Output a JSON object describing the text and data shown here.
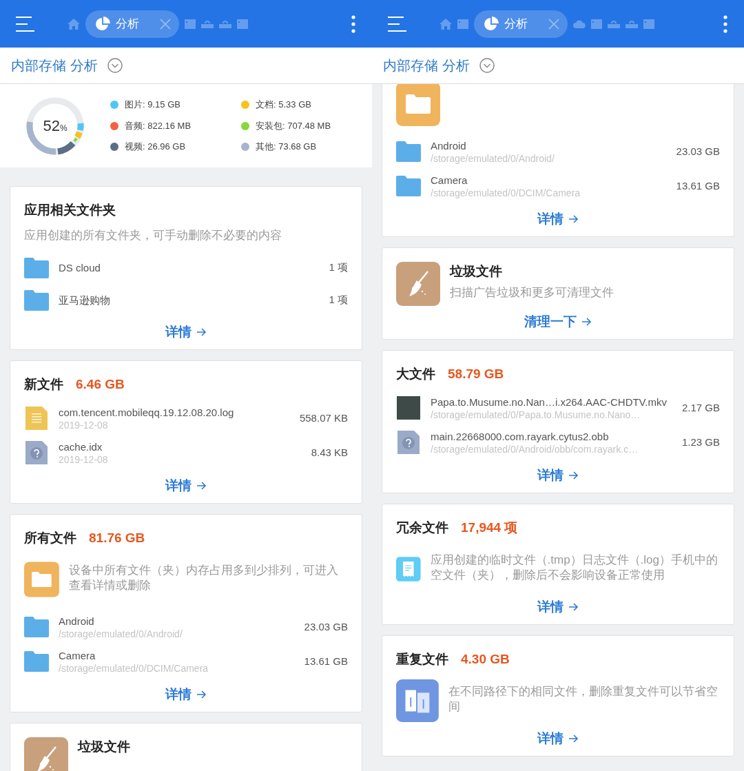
{
  "panes": [
    {
      "tabs": [
        {
          "kind": "home",
          "selected": false
        },
        {
          "kind": "analysis",
          "label": "分析",
          "selected": true
        },
        {
          "kind": "card",
          "selected": false
        },
        {
          "kind": "network",
          "selected": false
        },
        {
          "kind": "network",
          "selected": false
        },
        {
          "kind": "card",
          "selected": false
        }
      ],
      "location": "内部存储 分析",
      "scrolled_to_end": false,
      "summary": {
        "percent": "52",
        "unit": "%",
        "legend": [
          {
            "label": "图片: 9.15 GB",
            "color": "#4dc8f2"
          },
          {
            "label": "文档: 5.33 GB",
            "color": "#f7c21c"
          },
          {
            "label": "音频: 822.16 MB",
            "color": "#f2623e"
          },
          {
            "label": "安装包: 707.48 MB",
            "color": "#86d83a"
          },
          {
            "label": "视频: 26.96 GB",
            "color": "#5b6e85"
          },
          {
            "label": "其他: 73.68 GB",
            "color": "#a5b5cc"
          }
        ]
      },
      "cards": [
        {
          "kind": "plain",
          "title": "应用相关文件夹",
          "description": "应用创建的所有文件夹，可手动删除不必要的内容",
          "rows": [
            {
              "kind": "folder",
              "name": "DS cloud",
              "size": "1 项"
            },
            {
              "kind": "folder",
              "name": "亚马逊购物",
              "size": "1 项"
            }
          ],
          "action": "详情"
        },
        {
          "kind": "plain",
          "title": "新文件",
          "amount": "6.46 GB",
          "rows": [
            {
              "kind": "text-file",
              "name": "com.tencent.mobileqq.19.12.08.20.log",
              "sub": "2019-12-08",
              "size": "558.07 KB"
            },
            {
              "kind": "unknown-file",
              "name": "cache.idx",
              "sub": "2019-12-08",
              "size": "8.43 KB"
            }
          ],
          "action": "详情"
        },
        {
          "kind": "all-files",
          "title": "所有文件",
          "amount": "81.76 GB",
          "description": "设备中所有文件（夹）内存占用多到少排列，可进入查看详情或删除",
          "rows": [
            {
              "kind": "folder",
              "name": "Android",
              "sub": "/storage/emulated/0/Android/",
              "size": "23.03 GB"
            },
            {
              "kind": "folder",
              "name": "Camera",
              "sub": "/storage/emulated/0/DCIM/Camera",
              "size": "13.61 GB"
            }
          ],
          "action": "详情"
        },
        {
          "kind": "junk",
          "title": "垃圾文件"
        }
      ]
    },
    {
      "tabs": [
        {
          "kind": "home",
          "selected": false
        },
        {
          "kind": "card",
          "selected": false
        },
        {
          "kind": "analysis",
          "label": "分析",
          "selected": true
        },
        {
          "kind": "cloud",
          "selected": false
        },
        {
          "kind": "card",
          "selected": false
        },
        {
          "kind": "network",
          "selected": false
        },
        {
          "kind": "network",
          "selected": false
        },
        {
          "kind": "card",
          "selected": false
        }
      ],
      "location": "内部存储 分析",
      "scrolled_to_end": true,
      "cards": [
        {
          "kind": "all-files",
          "rows": [
            {
              "kind": "folder",
              "name": "Android",
              "sub": "/storage/emulated/0/Android/",
              "size": "23.03 GB"
            },
            {
              "kind": "folder",
              "name": "Camera",
              "sub": "/storage/emulated/0/DCIM/Camera",
              "size": "13.61 GB"
            }
          ],
          "action": "详情"
        },
        {
          "kind": "junk",
          "title": "垃圾文件",
          "description": "扫描广告垃圾和更多可清理文件",
          "action": "清理一下"
        },
        {
          "kind": "plain",
          "title": "大文件",
          "amount": "58.79 GB",
          "rows": [
            {
              "kind": "video",
              "name": "Papa.to.Musume.no.Nan…i.x264.AAC-CHDTV.mkv",
              "sub": "/storage/emulated/0/Papa.to.Musume.no.Nano…",
              "size": "2.17 GB"
            },
            {
              "kind": "unknown-file",
              "name": "main.22668000.com.rayark.cytus2.obb",
              "sub": "/storage/emulated/0/Android/obb/com.rayark.c…",
              "size": "1.23 GB"
            }
          ],
          "action": "详情"
        },
        {
          "kind": "redundant",
          "title": "冗余文件",
          "amount": "17,944 项",
          "description": "应用创建的临时文件（.tmp）日志文件（.log）手机中的空文件（夹），删除后不会影响设备正常使用",
          "action": "详情"
        },
        {
          "kind": "duplicates",
          "title": "重复文件",
          "amount": "4.30 GB",
          "description": "在不同路径下的相同文件，删除重复文件可以节省空间",
          "action": "详情"
        }
      ]
    }
  ]
}
